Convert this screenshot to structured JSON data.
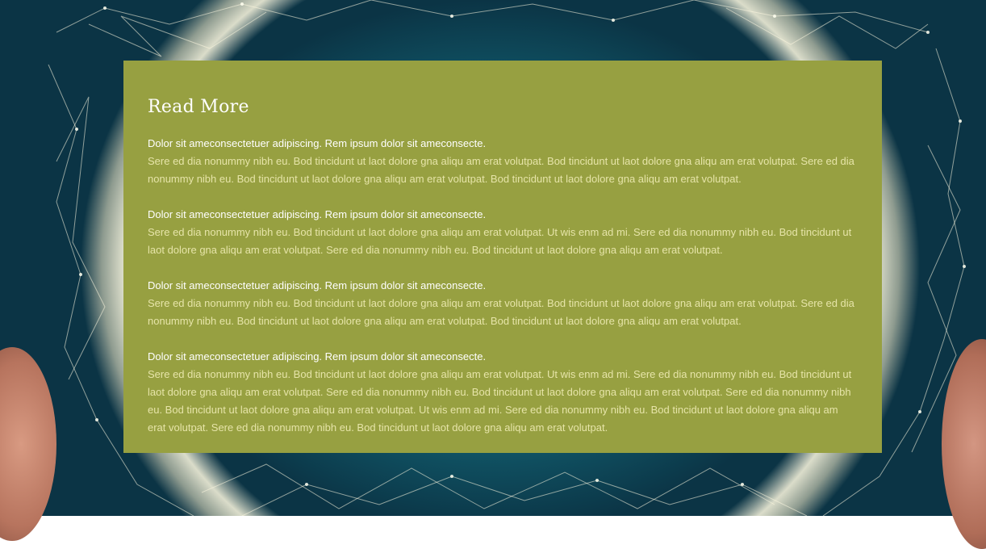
{
  "panel": {
    "title": "Read More",
    "entries": [
      {
        "heading": "Dolor sit ameconsectetuer adipiscing. Rem ipsum dolor sit ameconsecte.",
        "body": "Sere ed dia nonummy nibh eu. Bod tincidunt ut laot dolore gna aliqu am erat volutpat. Bod tincidunt ut laot dolore gna aliqu am erat volutpat. Sere ed dia nonummy nibh eu. Bod tincidunt ut laot dolore gna aliqu am erat volutpat. Bod tincidunt ut laot dolore gna aliqu am erat volutpat."
      },
      {
        "heading": "Dolor sit ameconsectetuer adipiscing. Rem ipsum dolor sit ameconsecte.",
        "body": "Sere ed dia nonummy nibh eu. Bod tincidunt ut laot dolore gna aliqu am erat volutpat. Ut wis enm ad mi. Sere ed dia nonummy nibh eu. Bod tincidunt ut laot dolore gna aliqu am erat volutpat. Sere ed dia nonummy nibh eu. Bod tincidunt ut laot dolore gna aliqu am erat volutpat."
      },
      {
        "heading": "Dolor sit ameconsectetuer adipiscing. Rem ipsum dolor sit ameconsecte.",
        "body": "Sere ed dia nonummy nibh eu. Bod tincidunt ut laot dolore gna aliqu am erat volutpat. Bod tincidunt ut laot dolore gna aliqu am erat volutpat. Sere ed dia nonummy nibh eu. Bod tincidunt ut laot dolore gna aliqu am erat volutpat. Bod tincidunt ut laot dolore gna aliqu am erat volutpat."
      },
      {
        "heading": "Dolor sit ameconsectetuer adipiscing. Rem ipsum dolor sit ameconsecte.",
        "body": "Sere ed dia nonummy nibh eu. Bod tincidunt ut laot dolore gna aliqu am erat volutpat. Ut wis enm ad mi. Sere ed dia nonummy nibh eu. Bod tincidunt ut laot dolore gna aliqu am erat volutpat. Sere ed dia nonummy nibh eu. Bod tincidunt ut laot dolore gna aliqu am erat volutpat. Sere ed dia nonummy nibh eu. Bod tincidunt ut laot dolore gna aliqu am erat volutpat. Ut wis enm ad mi. Sere ed dia nonummy nibh eu. Bod tincidunt ut laot dolore gna aliqu am erat volutpat. Sere ed dia nonummy nibh eu. Bod tincidunt ut laot dolore gna aliqu am erat volutpat."
      }
    ]
  },
  "colors": {
    "panel_background": "#97a041",
    "heading_text": "#ffffff",
    "body_text": "#e6e4a8",
    "background_accent": "#1d8fa0"
  },
  "background": {
    "image": "network-globe-illustration"
  }
}
